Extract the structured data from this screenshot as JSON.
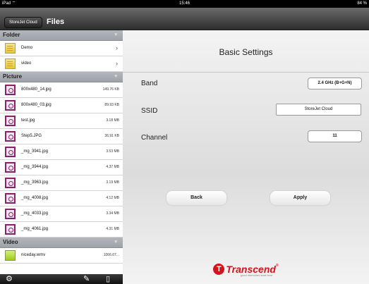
{
  "status_bar": {
    "device": "iPad",
    "time": "15:46",
    "battery": "84 %"
  },
  "left_nav": {
    "back_label": "StoreJet Cloud",
    "title": "Files"
  },
  "sections": {
    "folder": {
      "label": "Folder",
      "items": [
        {
          "name": "Demo"
        },
        {
          "name": "video"
        }
      ]
    },
    "picture": {
      "label": "Picture",
      "items": [
        {
          "name": "800x480_14.jpg",
          "size": "149.76 KB"
        },
        {
          "name": "800x480_03.jpg",
          "size": "89.93 KB"
        },
        {
          "name": "test.jpg",
          "size": "3.18 MB"
        },
        {
          "name": "Step5.JPG",
          "size": "36.91 KB"
        },
        {
          "name": "_mg_3941.jpg",
          "size": "3.53 MB"
        },
        {
          "name": "_mg_3944.jpg",
          "size": "4.37 MB"
        },
        {
          "name": "_mg_3963.jpg",
          "size": "3.19 MB"
        },
        {
          "name": "_mg_4008.jpg",
          "size": "4.12 MB"
        },
        {
          "name": "_mg_4033.jpg",
          "size": "3.34 MB"
        },
        {
          "name": "_mg_4061.jpg",
          "size": "4.31 MB"
        }
      ]
    },
    "video": {
      "label": "Video",
      "items": [
        {
          "name": "niceday.wmv",
          "size": "1066.67..."
        }
      ]
    }
  },
  "toolbar_icons": [
    "gear-icon",
    "edit-icon",
    "device-icon"
  ],
  "settings": {
    "title": "Basic Settings",
    "band_label": "Band",
    "band_value": "2.4 GHz (B+G+N)",
    "ssid_label": "SSID",
    "ssid_value": "StoreJet Cloud",
    "channel_label": "Channel",
    "channel_value": "11",
    "back_label": "Back",
    "apply_label": "Apply"
  },
  "brand": {
    "name": "Transcend",
    "mark": "T",
    "registered": "®",
    "tagline": "good memories start here",
    "color": "#d8121b"
  }
}
